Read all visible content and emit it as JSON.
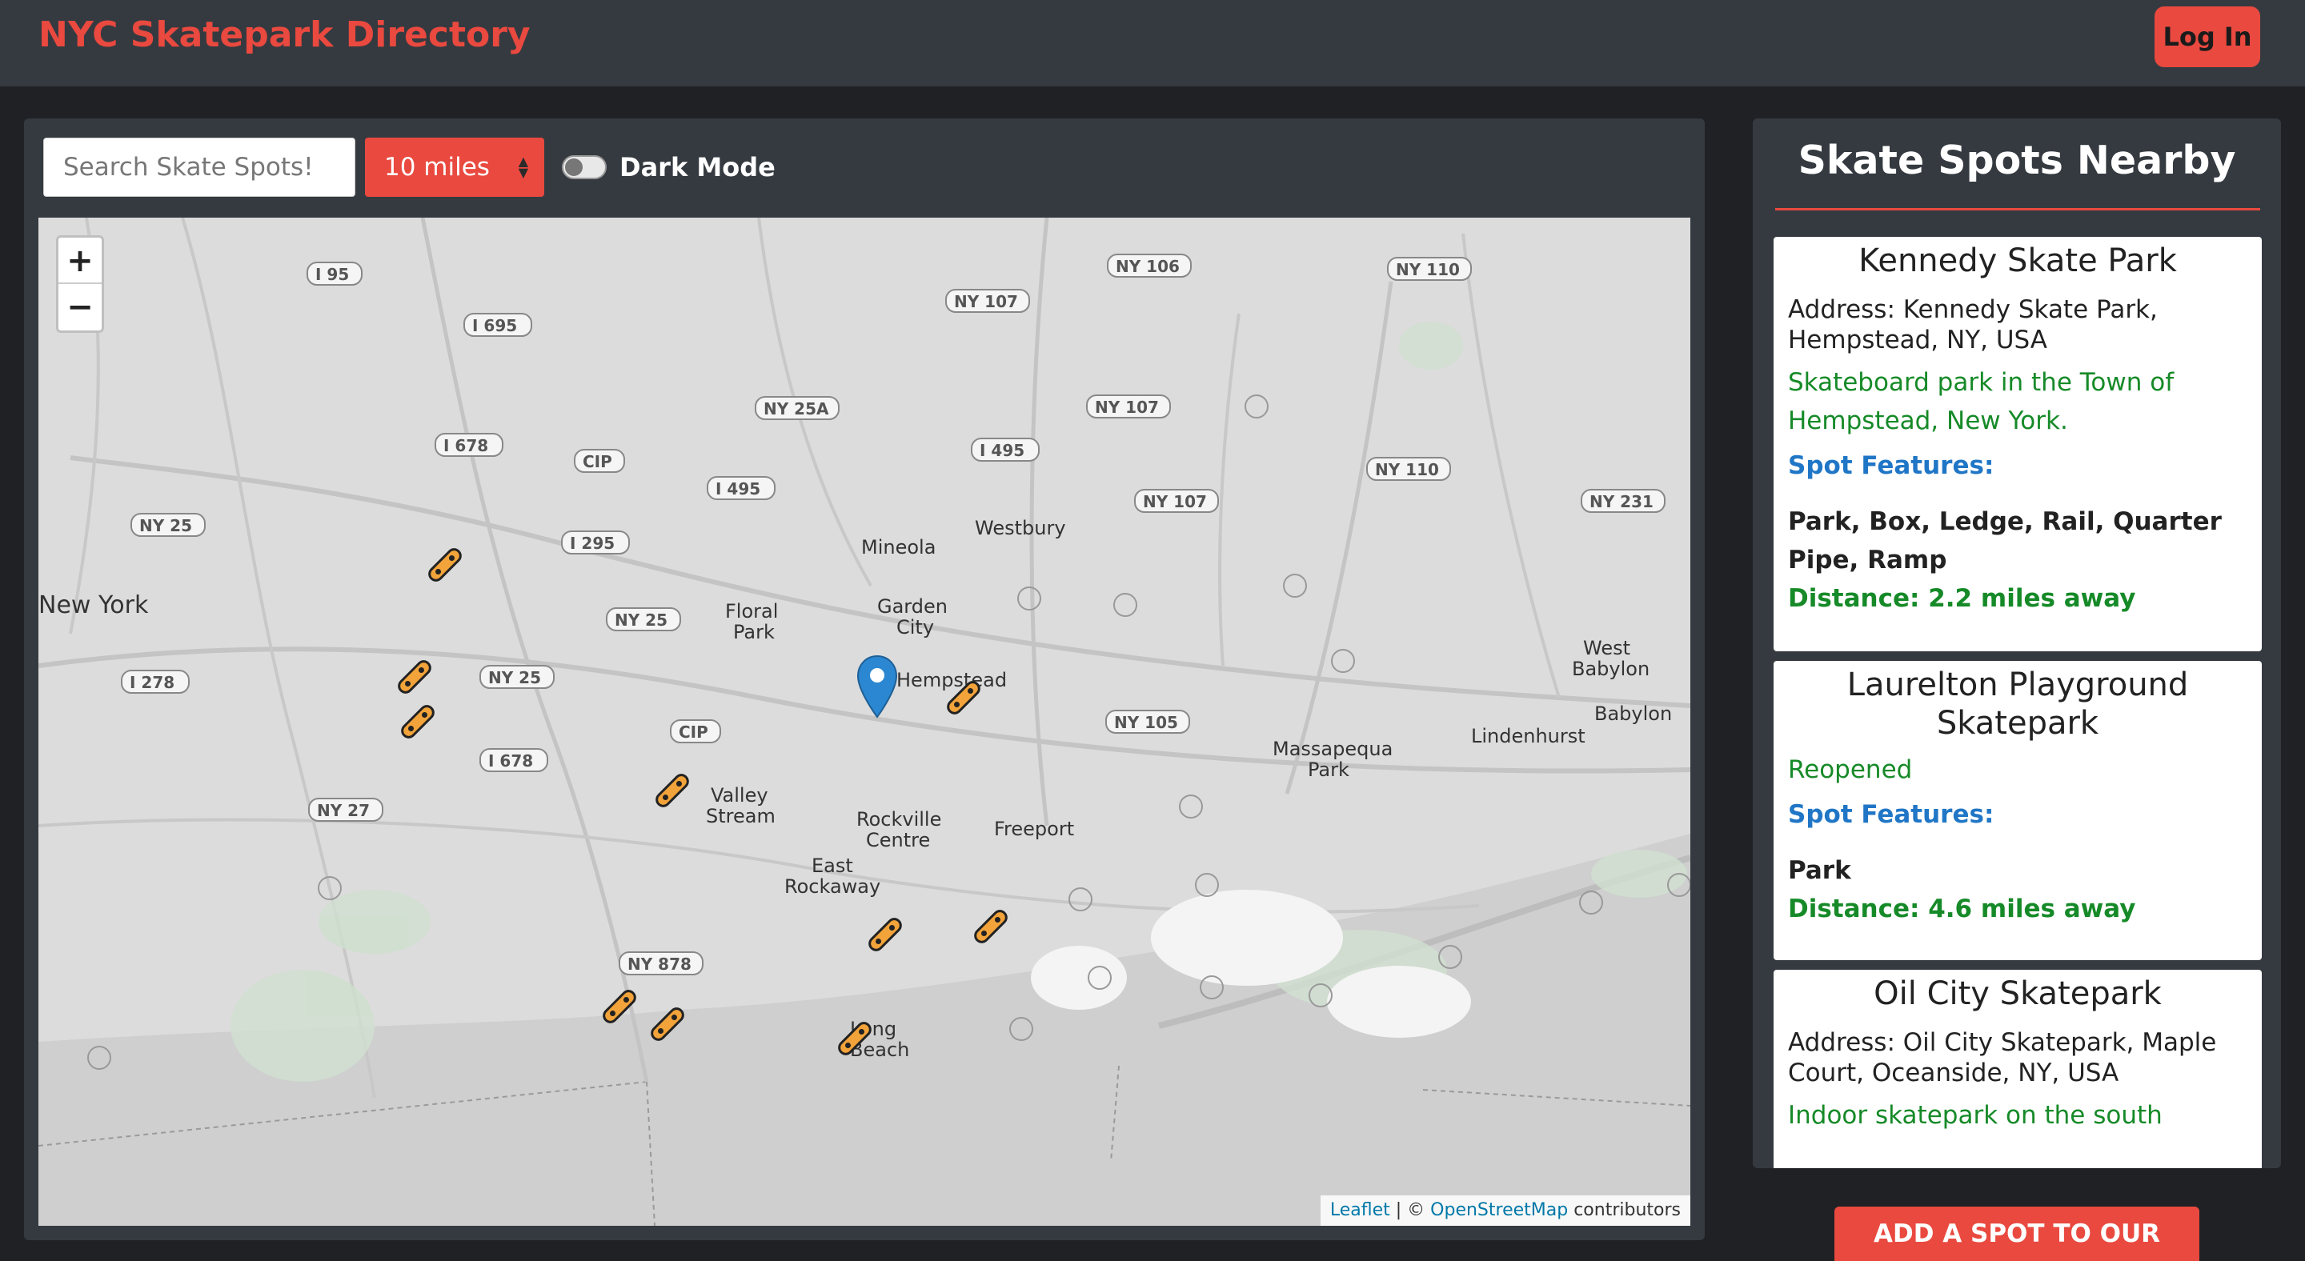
{
  "header": {
    "brand": "NYC Skatepark Directory",
    "login_label": "Log In"
  },
  "controls": {
    "search_placeholder": "Search Skate Spots!",
    "distance_selected": "10 miles",
    "dark_mode_label": "Dark Mode",
    "dark_mode_on": false
  },
  "map": {
    "zoom_in": "+",
    "zoom_out": "−",
    "attribution_leaflet": "Leaflet",
    "attribution_sep": " | © ",
    "attribution_osm": "OpenStreetMap",
    "attribution_rest": " contributors",
    "place_labels": [
      "New York",
      "Floral Park",
      "Garden City",
      "Mineola",
      "Westbury",
      "Hempstead",
      "Valley Stream",
      "Rockville Centre",
      "Freeport",
      "East Rockaway",
      "Long Beach",
      "Massapequa Park",
      "Lindenhurst",
      "West Babylon",
      "Babylon"
    ],
    "road_shields": [
      "I 95",
      "I 695",
      "I 678",
      "NY 25",
      "I 278",
      "NY 25A",
      "I 495",
      "I 295",
      "CIP",
      "NY 27",
      "I 678",
      "NY 878",
      "NY 106",
      "NY 107",
      "NY 110",
      "NY 107",
      "NY 107",
      "NY 110",
      "NY 231",
      "NY 105",
      "NY 25"
    ],
    "accent_color": "#e9493f",
    "marker_color": "#f2a33a",
    "pin_color": "#2b87d1"
  },
  "sidebar": {
    "title": "Skate Spots Nearby",
    "spots": [
      {
        "name": "Kennedy Skate Park",
        "address": "Address: Kennedy Skate Park, Hempstead, NY, USA",
        "description": "Skateboard park in the Town of Hempstead, New York.",
        "features_label": "Spot Features:",
        "features": "Park, Box, Ledge, Rail, Quarter Pipe, Ramp",
        "distance": "Distance: 2.2 miles away"
      },
      {
        "name": "Laurelton Playground Skatepark",
        "description": "Reopened",
        "features_label": "Spot Features:",
        "features": "Park",
        "distance": "Distance: 4.6 miles away"
      },
      {
        "name": "Oil City Skatepark",
        "address": "Address: Oil City Skatepark, Maple Court, Oceanside, NY, USA",
        "description": "Indoor skatepark on the south"
      }
    ]
  },
  "add_spot_label": "ADD A SPOT TO OUR MAP!"
}
